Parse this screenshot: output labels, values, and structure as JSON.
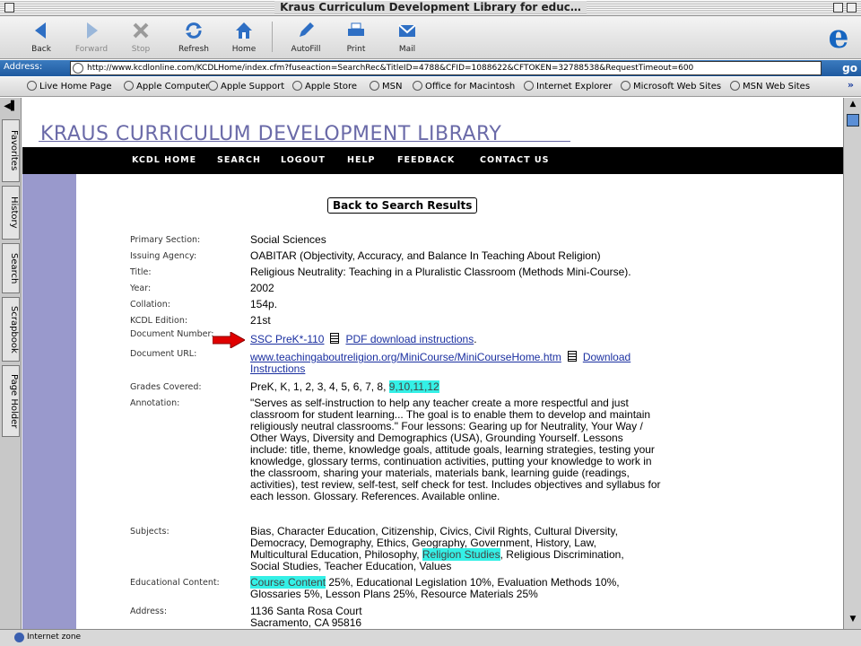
{
  "window": {
    "title": "Kraus Curriculum Development Library for educ…"
  },
  "toolbar": {
    "back": "Back",
    "forward": "Forward",
    "stop": "Stop",
    "refresh": "Refresh",
    "home": "Home",
    "autofill": "AutoFill",
    "print": "Print",
    "mail": "Mail"
  },
  "address": {
    "label": "Address:",
    "url": "http://www.kcdlonline.com/KCDLHome/index.cfm?fuseaction=SearchRec&TitleID=4788&CFID=1088622&CFTOKEN=32788538&RequestTimeout=600",
    "go": "go"
  },
  "favorites": [
    "Live Home Page",
    "Apple Computer",
    "Apple Support",
    "Apple Store",
    "MSN",
    "Office for Macintosh",
    "Internet Explorer",
    "Microsoft Web Sites",
    "MSN Web Sites"
  ],
  "sidebar_tabs": [
    "Favorites",
    "History",
    "Search",
    "Scrapbook",
    "Page Holder"
  ],
  "page": {
    "header_title": "KRAUS CURRICULUM DEVELOPMENT LIBRARY",
    "nav": [
      "KCDL HOME",
      "SEARCH",
      "LOGOUT",
      "HELP",
      "FEEDBACK",
      "CONTACT US"
    ],
    "back_button": "Back to Search Results",
    "fields": {
      "primary_section": {
        "label": "Primary Section:",
        "value": "Social Sciences"
      },
      "issuing_agency": {
        "label": "Issuing Agency:",
        "value": "OABITAR (Objectivity, Accuracy, and Balance In Teaching About Religion)"
      },
      "title": {
        "label": "Title:",
        "value": "Religious Neutrality: Teaching in a Pluralistic Classroom (Methods Mini-Course)."
      },
      "year": {
        "label": "Year:",
        "value": "2002"
      },
      "collation": {
        "label": "Collation:",
        "value": "154p."
      },
      "edition": {
        "label": "KCDL Edition:",
        "value": "21st"
      },
      "document_number": {
        "label": "Document Number:",
        "value": "SSC PreK*-110",
        "pdf_link": "PDF download instructions"
      },
      "document_url": {
        "label": "Document URL:",
        "value": "www.teachingaboutreligion.org/MiniCourse/MiniCourseHome.htm",
        "download_link": "Download Instructions"
      },
      "grades": {
        "label": "Grades Covered:",
        "plain": "PreK, K, 1, 2, 3, 4, 5, 6, 7, 8,",
        "highlighted": [
          "9",
          "10",
          "11",
          "12"
        ]
      },
      "annotation": {
        "label": "Annotation:",
        "value": "\"Serves as self-instruction to help any teacher create a more respectful and just classroom for student learning... The goal is to enable them to develop and maintain religiously neutral classrooms.\" Four lessons: Gearing up for Neutrality, Your Way / Other Ways, Diversity and Demographics (USA), Grounding Yourself. Lessons include: title, theme, knowledge goals, attitude goals, learning strategies, testing your knowledge, glossary terms, continuation activities, putting your knowledge to work in the classroom, sharing your materials, materials bank, learning guide (readings, activities), test review, self-test, self check for test. Includes objectives and syllabus for each lesson. Glossary. References. Available online."
      },
      "subjects": {
        "label": "Subjects:",
        "before": "Bias, Character Education, Citizenship, Civics, Civil Rights, Cultural Diversity, Democracy, Demography, Ethics, Geography, Government, History, Law, Multicultural Education, Philosophy, ",
        "highlighted": "Religion Studies",
        "after": ", Religious Discrimination, Social Studies, Teacher Education, Values"
      },
      "educational_content": {
        "label": "Educational Content:",
        "highlighted": "Course Content",
        "after": " 25%, Educational Legislation 10%, Evaluation Methods 10%, Glossaries 5%, Lesson Plans 25%, Resource Materials 25%"
      },
      "address": {
        "label": "Address:",
        "line1": "1136 Santa Rosa Court",
        "line2": "Sacramento, CA 95816"
      }
    }
  },
  "status": {
    "zone": "Internet zone"
  },
  "colors": {
    "header": "#6a6aa8",
    "leftcol": "#9999cc",
    "highlight": "#34f0e6",
    "link": "#1a2fa0",
    "arrow": "#e00000"
  }
}
